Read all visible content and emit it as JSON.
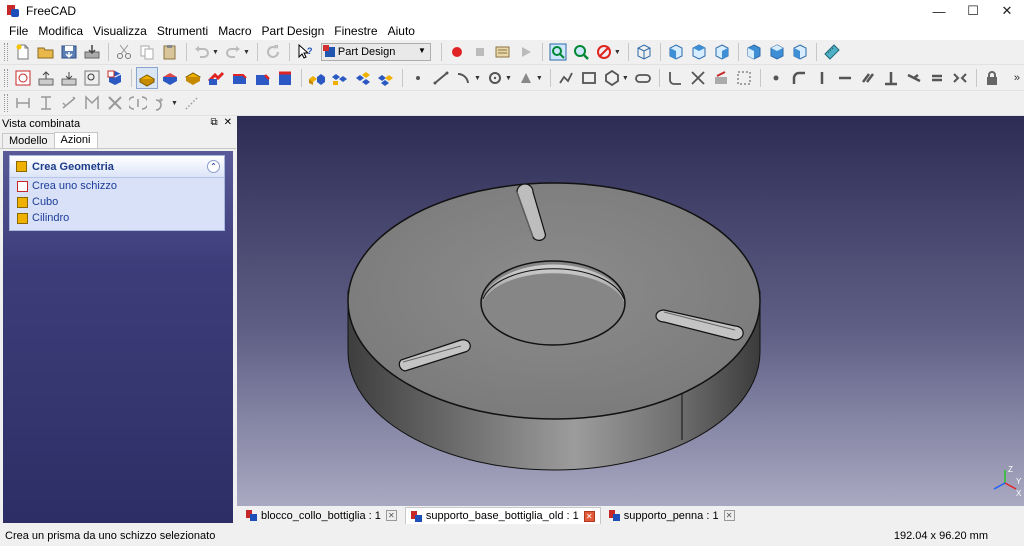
{
  "window": {
    "title": "FreeCAD"
  },
  "menu": [
    "File",
    "Modifica",
    "Visualizza",
    "Strumenti",
    "Macro",
    "Part Design",
    "Finestre",
    "Aiuto"
  ],
  "workbench": {
    "selected": "Part Design"
  },
  "combo_view": {
    "title": "Vista combinata",
    "tabs": [
      "Modello",
      "Azioni"
    ],
    "active_tab": "Azioni"
  },
  "task_panel": {
    "header": "Crea Geometria",
    "items": [
      "Crea uno schizzo",
      "Cubo",
      "Cilindro"
    ]
  },
  "doc_tabs": [
    {
      "label": "blocco_collo_bottiglia : 1",
      "active": false
    },
    {
      "label": "supporto_base_bottiglia_old : 1",
      "active": true
    },
    {
      "label": "supporto_penna : 1",
      "active": false
    }
  ],
  "status": {
    "message": "Crea un prisma da uno schizzo selezionato",
    "dimensions": "192.04 x 96.20 mm"
  },
  "axis": {
    "x": "X",
    "y": "Y",
    "z": "Z"
  },
  "colors": {
    "accent": "#1e4fb8",
    "brand_red": "#c62828",
    "view_top": "#2c2c55",
    "view_bottom": "#a9a9c2"
  }
}
